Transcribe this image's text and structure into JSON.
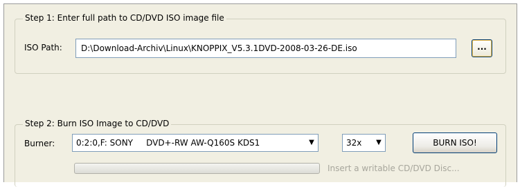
{
  "step1": {
    "title": "Step 1: Enter full path to CD/DVD ISO image file",
    "iso_path_label": "ISO Path:",
    "iso_path_value": "D:\\Download-Archiv\\Linux\\KNOPPIX_V5.3.1DVD-2008-03-26-DE.iso",
    "browse_label": "..."
  },
  "step2": {
    "title": "Step 2: Burn ISO Image to CD/DVD",
    "burner_label": "Burner:",
    "burner_value": "0:2:0,F: SONY     DVD+-RW AW-Q160S KDS1",
    "speed_value": "32x",
    "burn_button_label": "BURN ISO!",
    "progress": 0,
    "status_text": "Insert a writable CD/DVD Disc..."
  },
  "icons": {
    "dropdown": "chevron-down-icon"
  }
}
